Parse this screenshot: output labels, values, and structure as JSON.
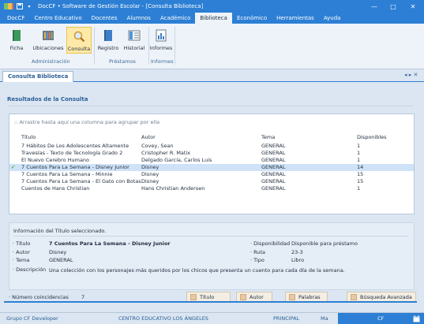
{
  "titlebar": {
    "title": "DocCF • Software de Gestión Escolar  - [Consulta Biblioteca]",
    "minimize": "—",
    "maximize": "□",
    "close": "✕"
  },
  "menu": [
    "DocCF",
    "Centro Educativo",
    "Docentes",
    "Alumnos",
    "Académico",
    "Biblioteca",
    "Económico",
    "Herramientas",
    "Ayuda"
  ],
  "menu_active_index": 5,
  "ribbon": {
    "buttons": {
      "ficha": "Ficha",
      "ubicaciones": "Ubicaciones",
      "consulta": "Consulta",
      "registro": "Registro",
      "historial": "Historial",
      "informes": "Informes"
    },
    "groups": {
      "administracion": "Administración",
      "prestamos": "Préstamos",
      "informes": "Informes"
    }
  },
  "doc_tab": {
    "label": "Consulta Biblioteca",
    "nav": "◂ ▸ ✕"
  },
  "results": {
    "title": "Resultados de la Consulta",
    "group_hint": ":: Arrastre hasta aquí una columna para agrupar por ella",
    "columns": {
      "titulo": "Título",
      "autor": "Autor",
      "tema": "Tema",
      "disponibles": "Disponibles"
    },
    "rows": [
      {
        "titulo": "7 Hábitos De Los Adolescentes Altamente",
        "autor": "Covey, Sean",
        "tema": "GENERAL",
        "disponibles": "1"
      },
      {
        "titulo": "Travesías - Texto de Tecnología Grado 2",
        "autor": "Cristopher R. Matix",
        "tema": "GENERAL",
        "disponibles": "1"
      },
      {
        "titulo": "El Nuevo Cerebro Humano",
        "autor": "Delgado García, Carlos Luis",
        "tema": "GENERAL",
        "disponibles": "1"
      },
      {
        "titulo": "7 Cuentos Para La Semana - Disney Junior",
        "autor": "Disney",
        "tema": "GENERAL",
        "disponibles": "14"
      },
      {
        "titulo": "7 Cuentos Para La Semana - Minnie",
        "autor": "Disney",
        "tema": "GENERAL",
        "disponibles": "15"
      },
      {
        "titulo": "7 Cuentos Para La Semana - El Gato con Botas",
        "autor": "Disney",
        "tema": "GENERAL",
        "disponibles": "15"
      },
      {
        "titulo": "Cuentos de Hans Christian",
        "autor": "Hans Christian Andersen",
        "tema": "GENERAL",
        "disponibles": "1"
      }
    ],
    "selected_row_index": 3,
    "selected_marker": "✔"
  },
  "info": {
    "title": "Información del Título seleccionado.",
    "labels": {
      "titulo": "· Título",
      "autor": "· Autor",
      "tema": "· Tema",
      "descripcion": "· Descripción",
      "disponibilidad": "· Disponibilidad",
      "ruta": "· Ruta",
      "tipo": "· Tipo"
    },
    "values": {
      "titulo": "7 Cuentos Para La Semana - Disney Junior",
      "autor": "Disney",
      "tema": "GENERAL",
      "descripcion": "Una colección con los personajes más queridos por los chicos que presenta un cuento para cada día de la semana.",
      "disponibilidad": "Disponible para préstamo",
      "ruta": "23-3",
      "tipo": "Libro"
    }
  },
  "bottom": {
    "count_label": "· Número coincidencias",
    "count_value": "7",
    "search_buttons": [
      "Título",
      "Autor",
      "Palabras",
      "Búsqueda Avanzada"
    ]
  },
  "status": {
    "group": "Grupo CF Developer",
    "center": "CENTRO EDUCATIVO LOS ÁNGELES",
    "role": "PRINCIPAL",
    "user": "Ma",
    "cf": "CF"
  },
  "colors": {
    "brand_blue": "#2c7fd4",
    "selection_row": "#cfe2f7",
    "ribbon_selected": "#ffe9a8",
    "check_green": "#57b847"
  },
  "icons": [
    "app-icon",
    "save-icon",
    "dropdown-icon",
    "ficha-icon",
    "ubicaciones-icon",
    "consulta-icon",
    "registro-icon",
    "historial-icon",
    "informes-icon",
    "calendar-icon",
    "check-icon"
  ]
}
